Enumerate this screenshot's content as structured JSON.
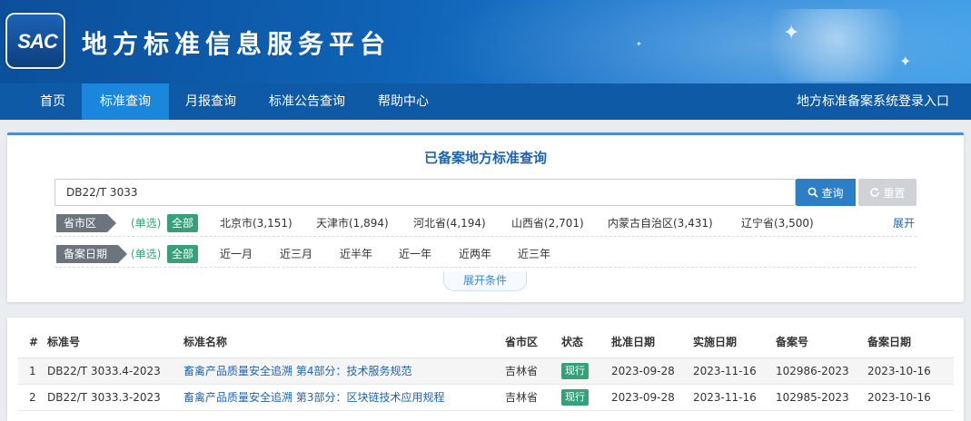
{
  "header": {
    "logo_text": "SAC",
    "site_title": "地方标准信息服务平台"
  },
  "nav": {
    "items": [
      {
        "label": "首页",
        "active": false
      },
      {
        "label": "标准查询",
        "active": true
      },
      {
        "label": "月报查询",
        "active": false
      },
      {
        "label": "标准公告查询",
        "active": false
      },
      {
        "label": "帮助中心",
        "active": false
      }
    ],
    "right_link": "地方标准备案系统登录入口"
  },
  "search": {
    "title": "已备案地方标准查询",
    "input_value": "DB22/T 3033",
    "search_button": "查询",
    "reset_button": "重置",
    "expand_conditions": "展开条件"
  },
  "filters": {
    "region": {
      "label": "省市区",
      "single": "(单选)",
      "all": "全部",
      "options": [
        "北京市(3,151)",
        "天津市(1,894)",
        "河北省(4,194)",
        "山西省(2,701)",
        "内蒙古自治区(3,431)",
        "辽宁省(3,500)"
      ],
      "expand": "展开"
    },
    "date": {
      "label": "备案日期",
      "single": "(单选)",
      "all": "全部",
      "options": [
        "近一月",
        "近三月",
        "近半年",
        "近一年",
        "近两年",
        "近三年"
      ]
    }
  },
  "table": {
    "headers": [
      "#",
      "标准号",
      "标准名称",
      "省市区",
      "状态",
      "批准日期",
      "实施日期",
      "备案号",
      "备案日期"
    ],
    "rows": [
      {
        "no": "1",
        "code": "DB22/T 3033.4-2023",
        "name": "畜禽产品质量安全追溯 第4部分：技术服务规范",
        "region": "吉林省",
        "status": "现行",
        "approve": "2023-09-28",
        "implement": "2023-11-16",
        "record_no": "102986-2023",
        "record_date": "2023-10-16"
      },
      {
        "no": "2",
        "code": "DB22/T 3033.3-2023",
        "name": "畜禽产品质量安全追溯 第3部分：区块链技术应用规程",
        "region": "吉林省",
        "status": "现行",
        "approve": "2023-09-28",
        "implement": "2023-11-16",
        "record_no": "102985-2023",
        "record_date": "2023-10-16"
      }
    ]
  },
  "colors": {
    "nav_bg": "#0e5aa6",
    "nav_active": "#1a86dc",
    "accent_green": "#35a07a",
    "link_blue": "#1d64b3"
  }
}
